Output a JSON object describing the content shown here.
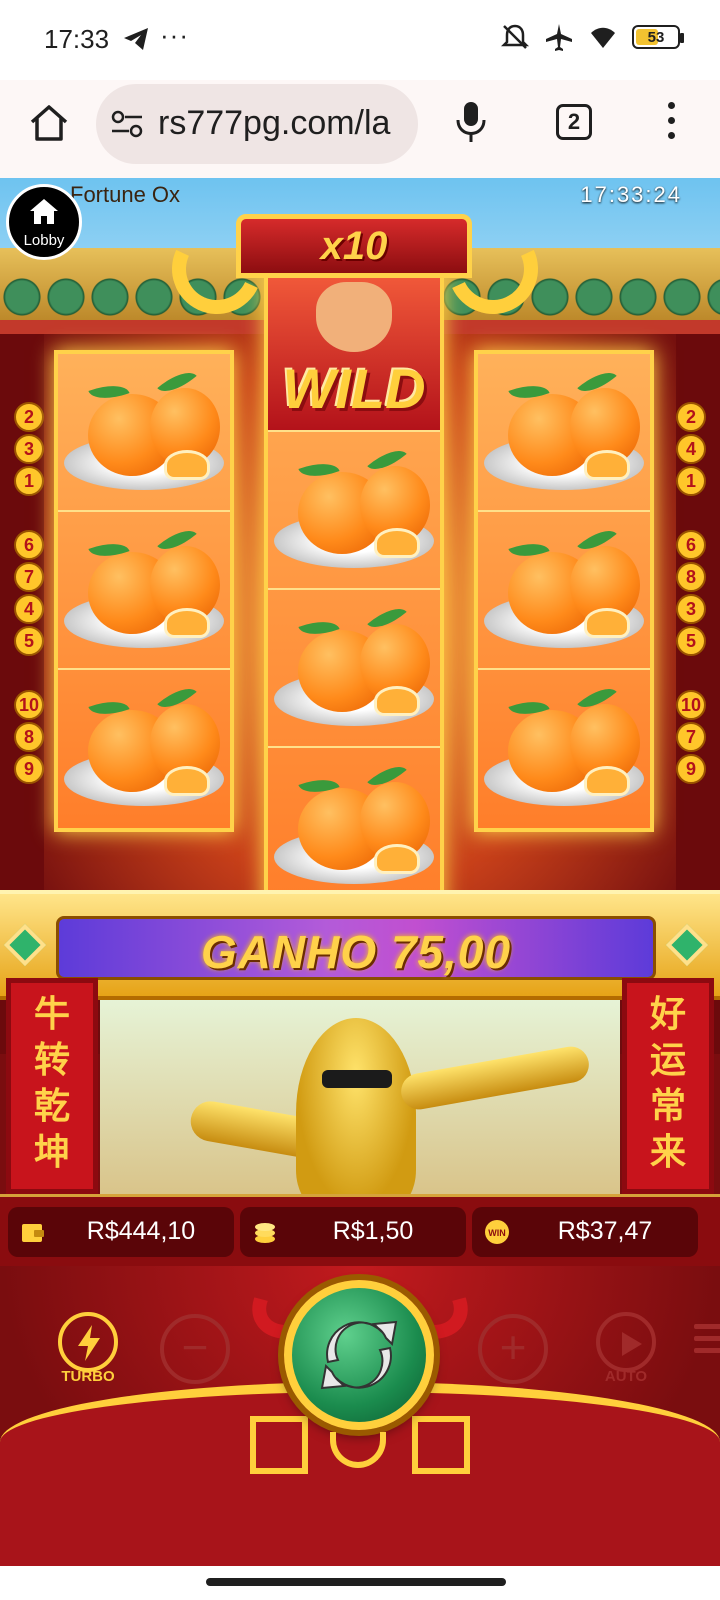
{
  "status_bar": {
    "time": "17:33",
    "more": "···",
    "battery_level": "53",
    "icons": [
      "telegram-icon",
      "bell-off-icon",
      "airplane-icon",
      "wifi-icon",
      "battery-icon"
    ]
  },
  "browser": {
    "url": "rs777pg.com/la",
    "tab_count": "2",
    "icons": [
      "home-icon",
      "site-settings-icon",
      "mic-icon",
      "tabs-icon",
      "more-vert-icon"
    ]
  },
  "game": {
    "title": "Fortune Ox",
    "clock": "17:33:24",
    "lobby_label": "Lobby",
    "multiplier": "x10",
    "wild_label": "WILD",
    "win_banner": "GANHO 75,00",
    "paylines_left": [
      "2",
      "3",
      "1",
      "6",
      "7",
      "4",
      "5",
      "10",
      "8",
      "9"
    ],
    "paylines_right": [
      "2",
      "4",
      "1",
      "6",
      "8",
      "3",
      "5",
      "10",
      "7",
      "9"
    ],
    "symbols": "tangerine-symbol",
    "pillar_left": [
      "牛",
      "转",
      "乾",
      "坤"
    ],
    "pillar_right": [
      "好",
      "运",
      "常",
      "来"
    ],
    "balance": "R$444,10",
    "bet": "R$1,50",
    "win": "R$37,47",
    "turbo_label": "TURBO",
    "auto_label": "AUTO",
    "minus": "−",
    "plus": "+"
  },
  "colors": {
    "frame_gold": "#ffd24a",
    "banner_purple": "#5d3bd9",
    "spin_green": "#1b8c4e",
    "background_red": "#7a0d0f"
  }
}
